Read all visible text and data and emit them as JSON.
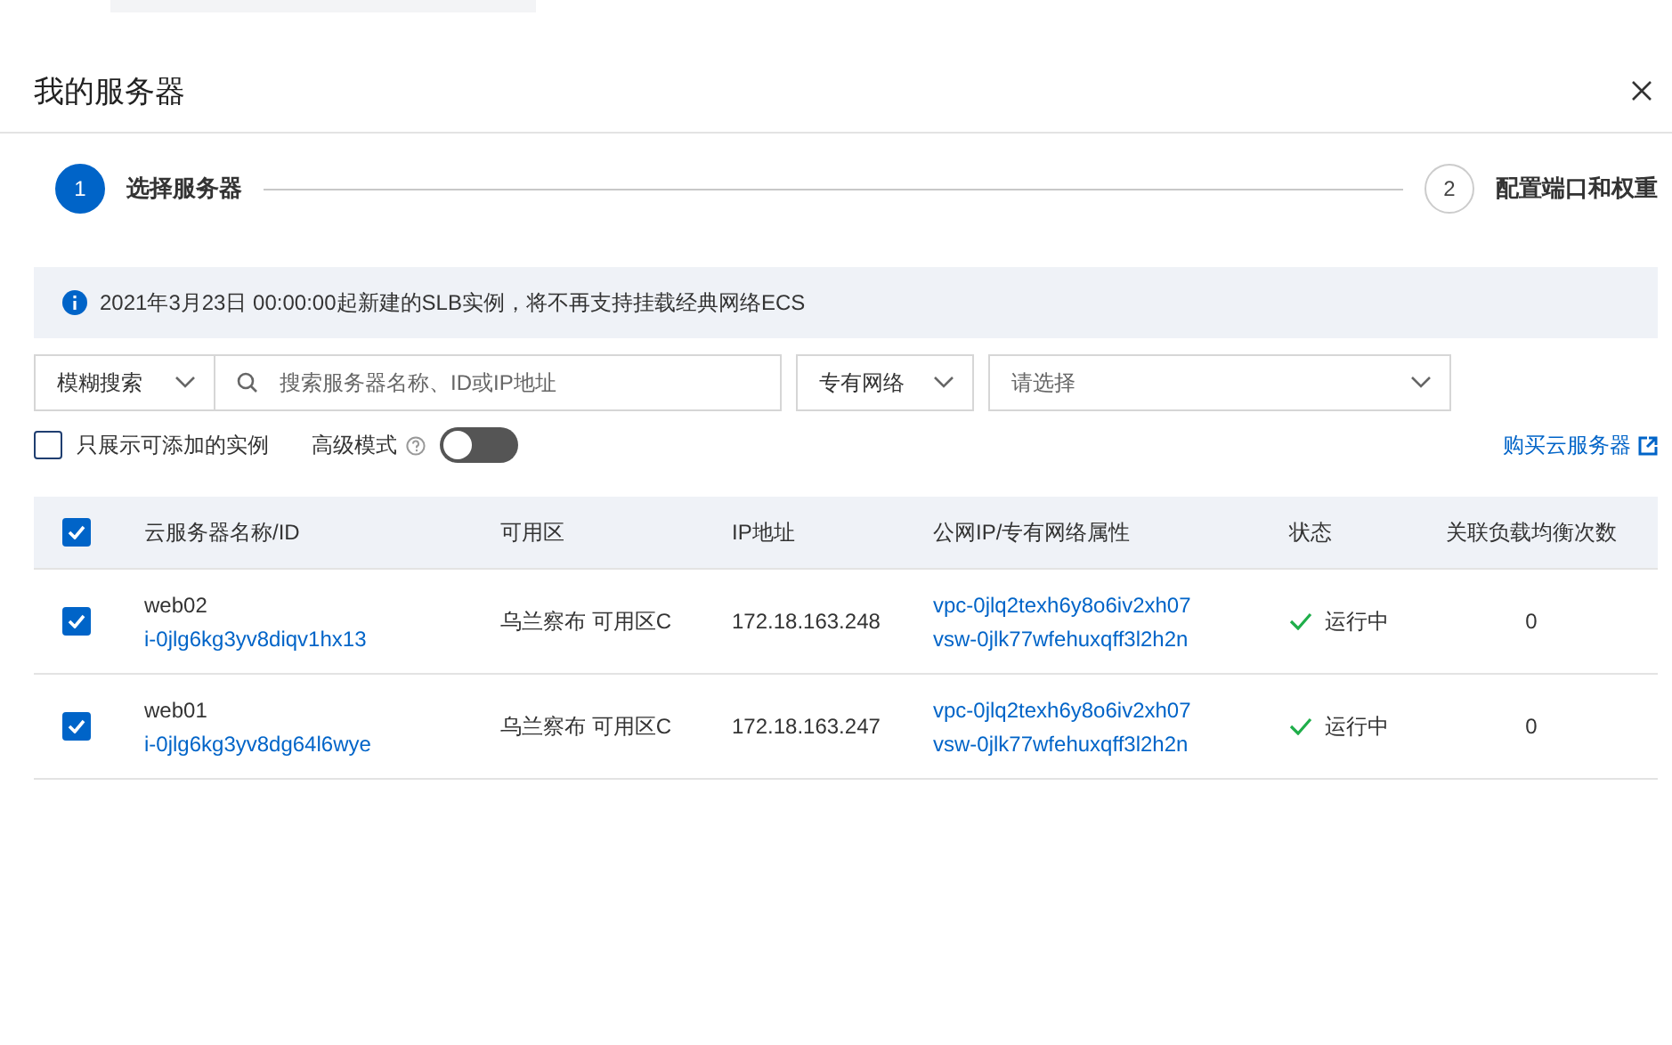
{
  "title": "我的服务器",
  "steps": [
    {
      "number": "1",
      "label": "选择服务器",
      "selected": true
    },
    {
      "number": "2",
      "label": "配置端口和权重",
      "selected": false
    }
  ],
  "notice": "2021年3月23日 00:00:00起新建的SLB实例，将不再支持挂载经典网络ECS",
  "filters": {
    "mode": "模糊搜索",
    "search_placeholder": "搜索服务器名称、ID或IP地址",
    "network": "专有网络",
    "select_placeholder": "请选择"
  },
  "options": {
    "only_addable": {
      "label": "只展示可添加的实例",
      "checked": false
    },
    "advanced": {
      "label": "高级模式",
      "on": false
    },
    "buy_link": "购买云服务器"
  },
  "table": {
    "all_checked": true,
    "columns": [
      "云服务器名称/ID",
      "可用区",
      "IP地址",
      "公网IP/专有网络属性",
      "状态",
      "关联负载均衡次数"
    ],
    "rows": [
      {
        "checked": true,
        "name": "web02",
        "id": "i-0jlg6kg3yv8diqv1hx13",
        "zone": "乌兰察布 可用区C",
        "ip": "172.18.163.248",
        "vpc": "vpc-0jlq2texh6y8o6iv2xh07",
        "vsw": "vsw-0jlk77wfehuxqff3l2h2n",
        "status": "运行中",
        "count": "0"
      },
      {
        "checked": true,
        "name": "web01",
        "id": "i-0jlg6kg3yv8dg64l6wye",
        "zone": "乌兰察布 可用区C",
        "ip": "172.18.163.247",
        "vpc": "vpc-0jlq2texh6y8o6iv2xh07",
        "vsw": "vsw-0jlk77wfehuxqff3l2h2n",
        "status": "运行中",
        "count": "0"
      }
    ]
  }
}
